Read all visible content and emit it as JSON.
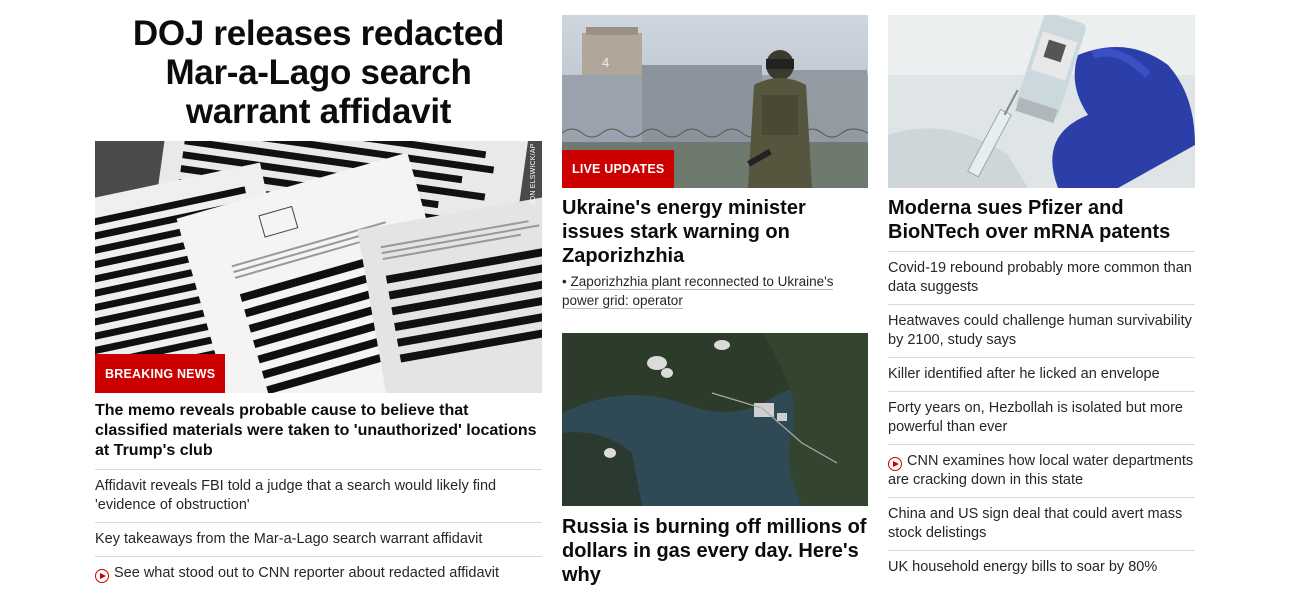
{
  "main": {
    "title": "DOJ releases redacted Mar-a-Lago search warrant affidavit",
    "badge": "BREAKING NEWS",
    "credit": "JON ELSWICK/AP",
    "lead": "The memo reveals probable cause to believe that classified materials were taken to 'unauthorized' locations at Trump's club",
    "links": [
      "Affidavit reveals FBI told a judge that a search would likely find 'evidence of obstruction'",
      "Key takeaways from the Mar-a-Lago search warrant affidavit",
      "See what stood out to CNN reporter about redacted affidavit"
    ]
  },
  "ukraine": {
    "badge": "LIVE UPDATES",
    "headline": "Ukraine's energy minister issues stark warning on Zaporizhzhia",
    "bullet": "Zaporizhzhia plant reconnected to Ukraine's power grid: operator"
  },
  "russia": {
    "headline": "Russia is burning off millions of dollars in gas every day. Here's why"
  },
  "moderna": {
    "headline": "Moderna sues Pfizer and BioNTech over mRNA patents",
    "links": [
      "Covid-19 rebound probably more common than data suggests",
      "Heatwaves could challenge human survivability by 2100, study says",
      "Killer identified after he licked an envelope",
      "Forty years on, Hezbollah is isolated but more powerful than ever",
      "CNN examines how local water departments are cracking down in this state",
      "China and US sign deal that could avert mass stock delistings",
      "UK household energy bills to soar by 80%"
    ]
  },
  "colors": {
    "accent": "#cc0000",
    "text": "#0c0c0c",
    "divider": "#d9d9d9"
  }
}
